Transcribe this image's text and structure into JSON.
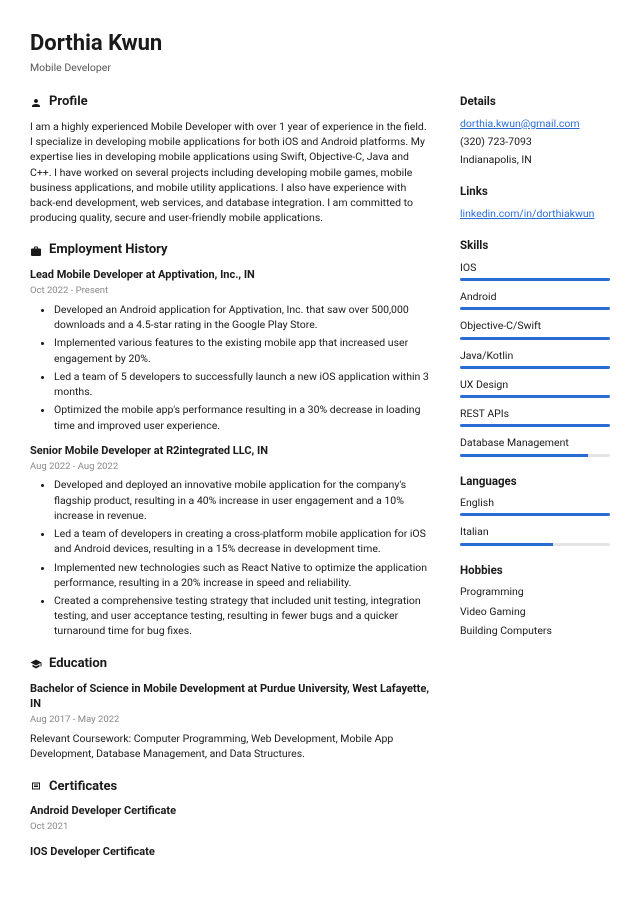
{
  "header": {
    "name": "Dorthia Kwun",
    "role": "Mobile Developer"
  },
  "profile": {
    "title": "Profile",
    "text": "I am a highly experienced Mobile Developer with over 1 year of experience in the field. I specialize in developing mobile applications for both iOS and Android platforms. My expertise lies in developing mobile applications using Swift, Objective-C, Java and C++. I have worked on several projects including developing mobile games, mobile business applications, and mobile utility applications. I also have experience with back-end development, web services, and database integration. I am committed to producing quality, secure and user-friendly mobile applications."
  },
  "employment": {
    "title": "Employment History",
    "jobs": [
      {
        "title": "Lead Mobile Developer at Apptivation, Inc., IN",
        "date": "Oct 2022 - Present",
        "bullets": [
          "Developed an Android application for Apptivation, Inc. that saw over 500,000 downloads and a 4.5-star rating in the Google Play Store.",
          "Implemented various features to the existing mobile app that increased user engagement by 20%.",
          "Led a team of 5 developers to successfully launch a new iOS application within 3 months.",
          "Optimized the mobile app's performance resulting in a 30% decrease in loading time and improved user experience."
        ]
      },
      {
        "title": "Senior Mobile Developer at R2integrated LLC, IN",
        "date": "Aug 2022 - Aug 2022",
        "bullets": [
          "Developed and deployed an innovative mobile application for the company's flagship product, resulting in a 40% increase in user engagement and a 10% increase in revenue.",
          "Led a team of developers in creating a cross-platform mobile application for iOS and Android devices, resulting in a 15% decrease in development time.",
          "Implemented new technologies such as React Native to optimize the application performance, resulting in a 20% increase in speed and reliability.",
          "Created a comprehensive testing strategy that included unit testing, integration testing, and user acceptance testing, resulting in fewer bugs and a quicker turnaround time for bug fixes."
        ]
      }
    ]
  },
  "education": {
    "title": "Education",
    "items": [
      {
        "title": "Bachelor of Science in Mobile Development at Purdue University, West Lafayette, IN",
        "date": "Aug 2017 - May 2022",
        "desc": "Relevant Coursework: Computer Programming, Web Development, Mobile App Development, Database Management, and Data Structures."
      }
    ]
  },
  "certificates": {
    "title": "Certificates",
    "items": [
      {
        "title": "Android Developer Certificate",
        "date": "Oct 2021"
      },
      {
        "title": "IOS Developer Certificate",
        "date": ""
      }
    ]
  },
  "details": {
    "title": "Details",
    "email": "dorthia.kwun@gmail.com",
    "phone": "(320) 723-7093",
    "location": "Indianapolis, IN"
  },
  "links": {
    "title": "Links",
    "items": [
      "linkedin.com/in/dorthiakwun"
    ]
  },
  "skills": {
    "title": "Skills",
    "items": [
      {
        "name": "IOS",
        "level": 100
      },
      {
        "name": "Android",
        "level": 100
      },
      {
        "name": "Objective-C/Swift",
        "level": 100
      },
      {
        "name": "Java/Kotlin",
        "level": 100
      },
      {
        "name": "UX Design",
        "level": 100
      },
      {
        "name": "REST APIs",
        "level": 100
      },
      {
        "name": "Database Management",
        "level": 85
      }
    ]
  },
  "languages": {
    "title": "Languages",
    "items": [
      {
        "name": "English",
        "level": 100
      },
      {
        "name": "Italian",
        "level": 62
      }
    ]
  },
  "hobbies": {
    "title": "Hobbies",
    "items": [
      "Programming",
      "Video Gaming",
      "Building Computers"
    ]
  }
}
